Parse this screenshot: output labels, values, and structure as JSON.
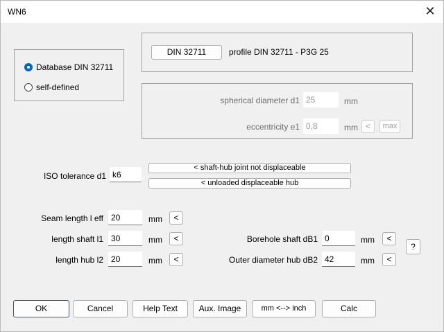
{
  "window": {
    "title": "WN6",
    "close_glyph": "✕"
  },
  "source": {
    "options": [
      {
        "label": "Database DIN 32711",
        "selected": true
      },
      {
        "label": "self-defined",
        "selected": false
      }
    ]
  },
  "profile": {
    "button_label": "DIN 32711",
    "description": "profile DIN 32711 - P3G 25"
  },
  "geometry": {
    "d1_label": "spherical diameter d1",
    "d1_value": "25",
    "d1_unit": "mm",
    "e1_label": "eccentricity e1",
    "e1_value": "0,8",
    "e1_unit": "mm",
    "e1_less": "<",
    "e1_max": "max"
  },
  "tolerance": {
    "label": "ISO tolerance d1",
    "value": "k6",
    "option1": "< shaft-hub joint not displaceable",
    "option2": "< unloaded displaceable hub"
  },
  "lengths": {
    "seam_label": "Seam length l eff",
    "seam_value": "20",
    "seam_unit": "mm",
    "seam_btn": "<",
    "shaft_label": "length shaft l1",
    "shaft_value": "30",
    "shaft_unit": "mm",
    "shaft_btn": "<",
    "hub_label": "length hub l2",
    "hub_value": "20",
    "hub_unit": "mm",
    "hub_btn": "<"
  },
  "bore": {
    "shaft_label": "Borehole shaft dB1",
    "shaft_value": "0",
    "shaft_unit": "mm",
    "shaft_btn": "<",
    "hub_label": "Outer diameter hub dB2",
    "hub_value": "42",
    "hub_unit": "mm",
    "hub_btn": "<",
    "help": "?"
  },
  "footer": {
    "ok": "OK",
    "cancel": "Cancel",
    "help_text": "Help Text",
    "aux_image": "Aux. Image",
    "units": "mm <--> inch",
    "calc": "Calc"
  },
  "colors": {
    "accent": "#0067c0",
    "background": "#f0f0f0",
    "border": "#a0a0a0"
  }
}
